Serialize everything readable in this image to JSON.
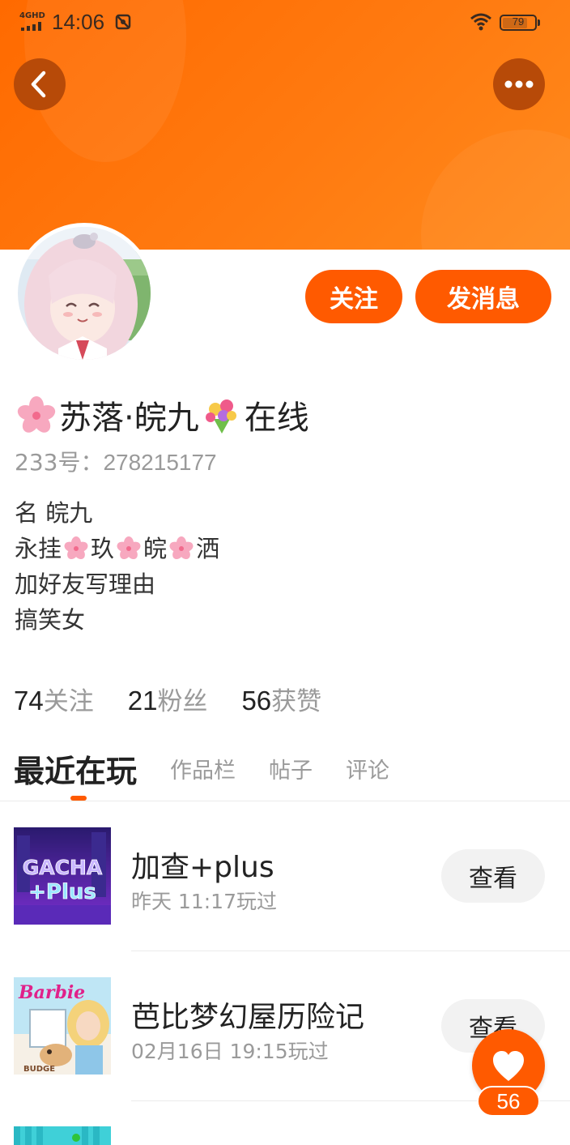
{
  "status_bar": {
    "network": "4GHD",
    "time": "14:06",
    "battery": "79",
    "battery_level": 0.79
  },
  "header": {
    "back_icon": "chevron-left-icon",
    "more_icon": "more-dots-icon"
  },
  "profile": {
    "name": "苏落·皖九",
    "name_suffix": "在线",
    "uid_label": "233号：",
    "uid": "278215177",
    "follow_label": "关注",
    "message_label": "发消息",
    "bio": {
      "line1": "名 皖九",
      "line2_parts": [
        "永挂",
        "玖",
        "皖",
        "洒"
      ],
      "line3": "加好友写理由",
      "line4": "搞笑女"
    }
  },
  "stats": [
    {
      "num": "74",
      "label": "关注"
    },
    {
      "num": "21",
      "label": "粉丝"
    },
    {
      "num": "56",
      "label": "获赞"
    }
  ],
  "tabs": [
    {
      "label": "最近在玩"
    },
    {
      "label": "作品栏"
    },
    {
      "label": "帖子"
    },
    {
      "label": "评论"
    }
  ],
  "games": [
    {
      "title": "加查+plus",
      "meta": "昨天 11:17玩过",
      "view_label": "查看",
      "thumb_line1": "GACHA",
      "thumb_line2": "+Plus"
    },
    {
      "title": "芭比梦幻屋历险记",
      "meta": "02月16日 19:15玩过",
      "view_label": "查看",
      "thumb_brand": "Barbie",
      "thumb_sub": "BUDGE"
    }
  ],
  "like": {
    "count": "56"
  },
  "colors": {
    "accent": "#ff5a00",
    "banner": "#ff7a10",
    "muted_text": "#9a9a9a"
  }
}
